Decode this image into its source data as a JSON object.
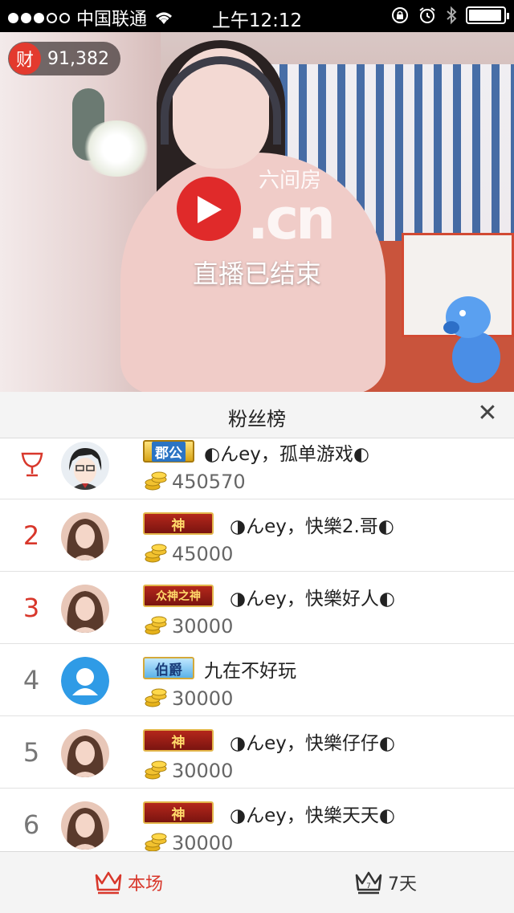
{
  "status_bar": {
    "carrier": "中国联通",
    "time": "上午12:12",
    "battery_level": 0.95
  },
  "video": {
    "wealth_badge": "财",
    "wealth_value": "91,382",
    "logo_brand": "六间房",
    "logo_domain": ".cn",
    "ended_text": "直播已结束"
  },
  "panel": {
    "title": "粉丝榜",
    "close_symbol": "✕"
  },
  "ranking": [
    {
      "rank": "",
      "rank_icon": "trophy-icon",
      "badge": "郡公",
      "badge_style": "gold-blue",
      "name": "◐んey，孤单游戏◐",
      "coins": "450570",
      "avatar": "anime-boy"
    },
    {
      "rank": "2",
      "badge": "神",
      "badge_style": "red-shen",
      "name": "◑んey，快樂2.哥◐",
      "coins": "45000",
      "avatar": "girl"
    },
    {
      "rank": "3",
      "badge": "众神之神",
      "badge_style": "red-shen",
      "name": "◑んey，快樂好人◐",
      "coins": "30000",
      "avatar": "girl"
    },
    {
      "rank": "4",
      "badge": "伯爵",
      "badge_style": "blue-bo",
      "name": "九在不好玩",
      "coins": "30000",
      "avatar": "default-blue"
    },
    {
      "rank": "5",
      "badge": "神",
      "badge_style": "red-shen",
      "name": "◑んey，快樂仔仔◐",
      "coins": "30000",
      "avatar": "girl"
    },
    {
      "rank": "6",
      "badge": "神",
      "badge_style": "red-shen",
      "name": "◑んey，快樂天天◐",
      "coins": "30000",
      "avatar": "girl"
    }
  ],
  "tabs": [
    {
      "label": "本场",
      "icon": "crown-icon",
      "active": true
    },
    {
      "label": "7天",
      "icon": "crown-7-icon",
      "active": false
    }
  ],
  "colors": {
    "accent_red": "#d8372b",
    "tab_active": "#d8372b",
    "tab_inactive": "#333333"
  }
}
